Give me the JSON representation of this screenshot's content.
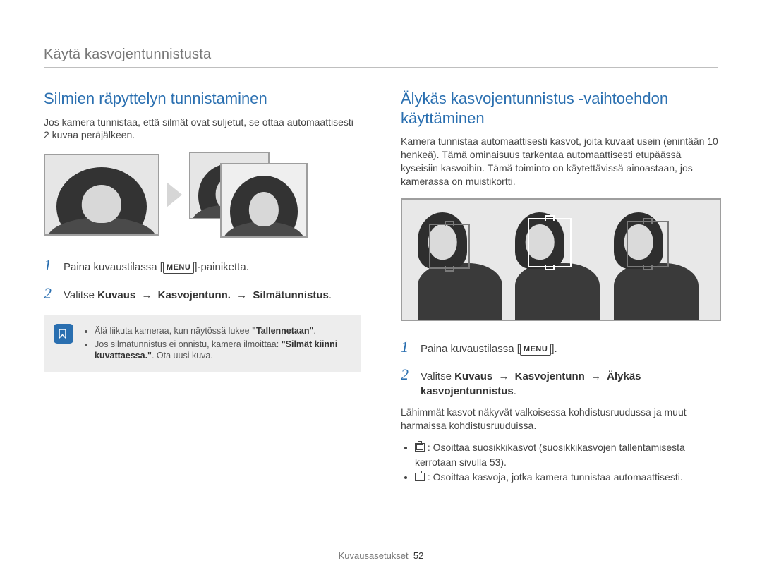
{
  "header": {
    "breadcrumb": "Käytä kasvojentunnistusta"
  },
  "left": {
    "title": "Silmien räpyttelyn tunnistaminen",
    "intro": "Jos kamera tunnistaa, että silmät ovat suljetut, se ottaa automaattisesti 2 kuvaa peräjälkeen.",
    "step1_before": "Paina kuvaustilassa [",
    "step1_after": "]-painiketta.",
    "step2_prefix": "Valitse ",
    "step2_b1": "Kuvaus",
    "step2_b2": "Kasvojentunn.",
    "step2_b3": "Silmätunnistus",
    "step2_arrow": "→",
    "step2_suffix": ".",
    "note": {
      "item1_a": "Älä liikuta kameraa, kun näytössä lukee ",
      "item1_q": "\"Tallennetaan\"",
      "item1_b": ".",
      "item2_a": "Jos silmätunnistus ei onnistu, kamera ilmoittaa: ",
      "item2_q": "\"Silmät kiinni kuvattaessa.\"",
      "item2_b": ". Ota uusi kuva."
    }
  },
  "right": {
    "title": "Älykäs kasvojentunnistus -vaihtoehdon käyttäminen",
    "intro": "Kamera tunnistaa automaattisesti kasvot, joita kuvaat usein (enintään 10 henkeä). Tämä ominaisuus tarkentaa automaattisesti etupäässä kyseisiin kasvoihin. Tämä toiminto on käytettävissä ainoastaan, jos kamerassa on muistikortti.",
    "step1_before": "Paina kuvaustilassa [",
    "step1_after": "].",
    "step2_prefix": "Valitse ",
    "step2_b1": "Kuvaus",
    "step2_b2": "Kasvojentunn",
    "step2_b3": "Älykäs kasvojentunnistus",
    "step2_arrow": "→",
    "step2_suffix": ".",
    "after": "Lähimmät kasvot näkyvät valkoisessa kohdistusruudussa ja muut harmaissa kohdistusruuduissa.",
    "bullet1": ": Osoittaa suosikkikasvot (suosikkikasvojen tallentamisesta kerrotaan sivulla 53).",
    "bullet2": ": Osoittaa kasvoja, jotka kamera tunnistaa automaattisesti."
  },
  "menu_label": "MENU",
  "footer": {
    "section": "Kuvausasetukset",
    "page": "52"
  }
}
